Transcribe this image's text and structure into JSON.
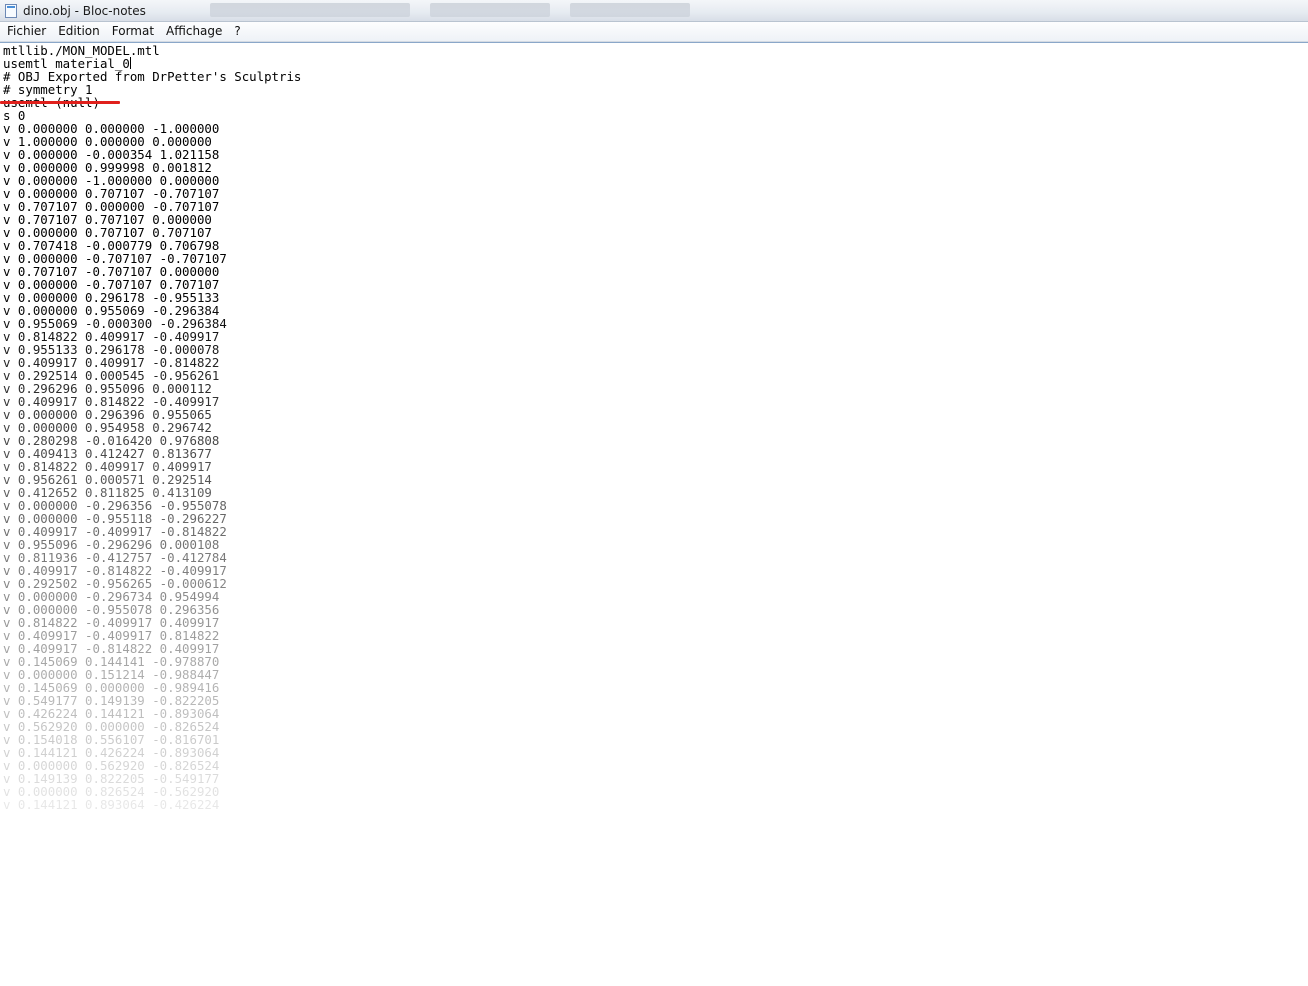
{
  "window": {
    "title": "dino.obj - Bloc-notes",
    "app_icon": "notepad-icon"
  },
  "menubar": {
    "items": [
      "Fichier",
      "Edition",
      "Format",
      "Affichage",
      "?"
    ]
  },
  "editor": {
    "lines": [
      "mtllib./MON_MODEL.mtl",
      "usemtl material_0",
      "# OBJ Exported from DrPetter's Sculptris",
      "# symmetry 1",
      "usemtl (null)",
      "s 0",
      "v 0.000000 0.000000 -1.000000",
      "v 1.000000 0.000000 0.000000",
      "v 0.000000 -0.000354 1.021158",
      "v 0.000000 0.999998 0.001812",
      "v 0.000000 -1.000000 0.000000",
      "v 0.000000 0.707107 -0.707107",
      "v 0.707107 0.000000 -0.707107",
      "v 0.707107 0.707107 0.000000",
      "v 0.000000 0.707107 0.707107",
      "v 0.707418 -0.000779 0.706798",
      "v 0.000000 -0.707107 -0.707107",
      "v 0.707107 -0.707107 0.000000",
      "v 0.000000 -0.707107 0.707107",
      "v 0.000000 0.296178 -0.955133",
      "v 0.000000 0.955069 -0.296384",
      "v 0.955069 -0.000300 -0.296384",
      "v 0.814822 0.409917 -0.409917",
      "v 0.955133 0.296178 -0.000078",
      "v 0.409917 0.409917 -0.814822",
      "v 0.292514 0.000545 -0.956261",
      "v 0.296296 0.955096 0.000112",
      "v 0.409917 0.814822 -0.409917",
      "v 0.000000 0.296396 0.955065",
      "v 0.000000 0.954958 0.296742",
      "v 0.280298 -0.016420 0.976808",
      "v 0.409413 0.412427 0.813677",
      "v 0.814822 0.409917 0.409917",
      "v 0.956261 0.000571 0.292514",
      "v 0.412652 0.811825 0.413109",
      "v 0.000000 -0.296356 -0.955078",
      "v 0.000000 -0.955118 -0.296227",
      "v 0.409917 -0.409917 -0.814822",
      "v 0.955096 -0.296296 0.000108",
      "v 0.811936 -0.412757 -0.412784",
      "v 0.409917 -0.814822 -0.409917",
      "v 0.292502 -0.956265 -0.000612",
      "v 0.000000 -0.296734 0.954994",
      "v 0.000000 -0.955078 0.296356",
      "v 0.814822 -0.409917 0.409917",
      "v 0.409917 -0.409917 0.814822",
      "v 0.409917 -0.814822 0.409917",
      "v 0.145069 0.144141 -0.978870",
      "v 0.000000 0.151214 -0.988447",
      "v 0.145069 0.000000 -0.989416",
      "v 0.549177 0.149139 -0.822205",
      "v 0.426224 0.144121 -0.893064",
      "v 0.562920 0.000000 -0.826524",
      "v 0.154018 0.556107 -0.816701",
      "v 0.144121 0.426224 -0.893064",
      "v 0.000000 0.562920 -0.826524",
      "v 0.149139 0.822205 -0.549177",
      "v 0.000000 0.826524 -0.562920",
      "v 0.144121 0.893064 -0.426224"
    ],
    "caret_line_index": 1,
    "struck_line_index": 4,
    "strike_color": "#e0201c",
    "fade_start_line": 18,
    "fade_end_line": 62
  }
}
